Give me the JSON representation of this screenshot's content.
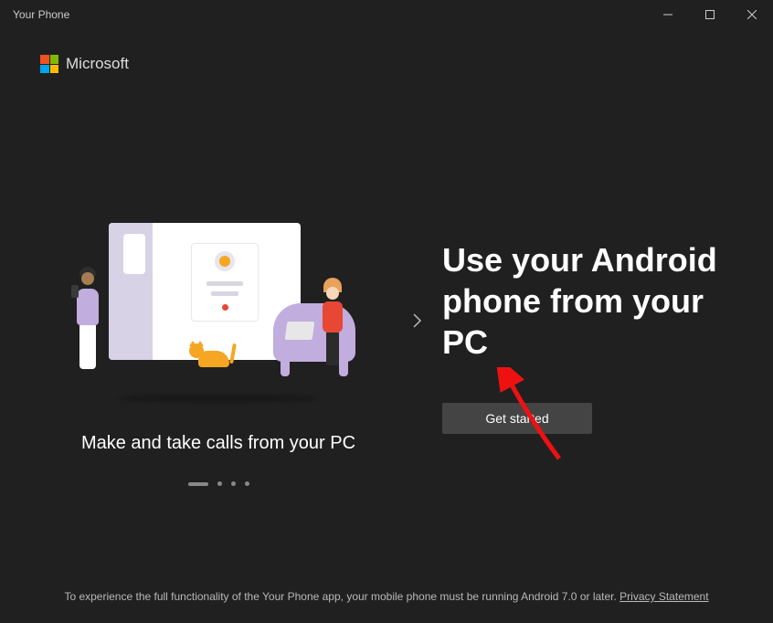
{
  "titlebar": {
    "title": "Your Phone"
  },
  "brand": {
    "name": "Microsoft"
  },
  "carousel": {
    "caption": "Make and take calls from your PC",
    "active_index": 0,
    "count": 4
  },
  "headline": "Use your Android phone from your PC",
  "cta": {
    "label": "Get started"
  },
  "footer": {
    "text": "To experience the full functionality of the Your Phone app, your mobile phone must be running Android 7.0 or later. ",
    "link_label": "Privacy Statement"
  }
}
